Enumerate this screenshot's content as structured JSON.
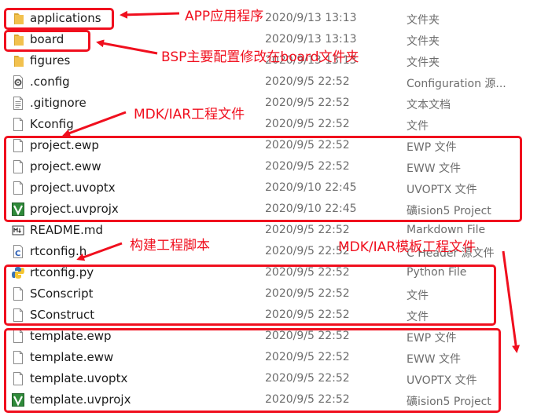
{
  "files": [
    {
      "name": "applications",
      "date": "2020/9/13 13:13",
      "type": "文件夹",
      "icon": "folder-icon"
    },
    {
      "name": "board",
      "date": "2020/9/13 13:13",
      "type": "文件夹",
      "icon": "folder-icon"
    },
    {
      "name": "figures",
      "date": "2020/9/13 13:13",
      "type": "文件夹",
      "icon": "folder-icon"
    },
    {
      "name": ".config",
      "date": "2020/9/5 22:52",
      "type": "Configuration 源...",
      "icon": "config-file-icon"
    },
    {
      "name": ".gitignore",
      "date": "2020/9/5 22:52",
      "type": "文本文档",
      "icon": "text-file-icon"
    },
    {
      "name": "Kconfig",
      "date": "2020/9/5 22:52",
      "type": "文件",
      "icon": "blank-file-icon"
    },
    {
      "name": "project.ewp",
      "date": "2020/9/5 22:52",
      "type": "EWP 文件",
      "icon": "blank-file-icon"
    },
    {
      "name": "project.eww",
      "date": "2020/9/5 22:52",
      "type": "EWW 文件",
      "icon": "blank-file-icon"
    },
    {
      "name": "project.uvoptx",
      "date": "2020/9/10 22:45",
      "type": "UVOPTX 文件",
      "icon": "blank-file-icon"
    },
    {
      "name": "project.uvprojx",
      "date": "2020/9/10 22:45",
      "type": "礦ision5 Project",
      "icon": "keil-project-icon"
    },
    {
      "name": "README.md",
      "date": "2020/9/5 22:52",
      "type": "Markdown File",
      "icon": "markdown-file-icon"
    },
    {
      "name": "rtconfig.h",
      "date": "2020/9/5 22:52",
      "type": "C Header 源文件",
      "icon": "c-header-file-icon"
    },
    {
      "name": "rtconfig.py",
      "date": "2020/9/5 22:52",
      "type": "Python File",
      "icon": "python-file-icon"
    },
    {
      "name": "SConscript",
      "date": "2020/9/5 22:52",
      "type": "文件",
      "icon": "blank-file-icon"
    },
    {
      "name": "SConstruct",
      "date": "2020/9/5 22:52",
      "type": "文件",
      "icon": "blank-file-icon"
    },
    {
      "name": "template.ewp",
      "date": "2020/9/5 22:52",
      "type": "EWP 文件",
      "icon": "blank-file-icon"
    },
    {
      "name": "template.eww",
      "date": "2020/9/5 22:52",
      "type": "EWW 文件",
      "icon": "blank-file-icon"
    },
    {
      "name": "template.uvoptx",
      "date": "2020/9/5 22:52",
      "type": "UVOPTX 文件",
      "icon": "blank-file-icon"
    },
    {
      "name": "template.uvprojx",
      "date": "2020/9/5 22:52",
      "type": "礦ision5 Project",
      "icon": "keil-project-icon"
    }
  ],
  "annotations": {
    "app": "APP应用程序",
    "bsp": "BSP主要配置修改在board文件夹",
    "mdk_project": "MDK/IAR工程文件",
    "build": "构建工程脚本",
    "mdk_template": "MDK/IAR模板工程文件"
  },
  "colors": {
    "annotation": "#f00f1e",
    "folder": "#f2c14e"
  }
}
